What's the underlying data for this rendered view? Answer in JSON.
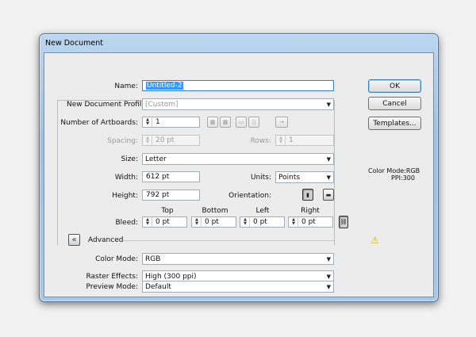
{
  "window": {
    "title": "New Document"
  },
  "form": {
    "name_label": "Name:",
    "name_value": "Untitled-2",
    "profile_label": "New Document Profile:",
    "profile_value": "[Custom]",
    "artboards_label": "Number of Artboards:",
    "artboards_value": "1",
    "spacing_label": "Spacing:",
    "spacing_value": "20 pt",
    "rows_label": "Rows:",
    "rows_value": "1",
    "size_label": "Size:",
    "size_value": "Letter",
    "width_label": "Width:",
    "width_value": "612 pt",
    "units_label": "Units:",
    "units_value": "Points",
    "height_label": "Height:",
    "height_value": "792 pt",
    "orientation_label": "Orientation:",
    "bleed_label": "Bleed:",
    "bleed": {
      "top_label": "Top",
      "top_value": "0 pt",
      "bottom_label": "Bottom",
      "bottom_value": "0 pt",
      "left_label": "Left",
      "left_value": "0 pt",
      "right_label": "Right",
      "right_value": "0 pt"
    },
    "advanced_label": "Advanced",
    "color_mode_label": "Color Mode:",
    "color_mode_value": "RGB",
    "raster_label": "Raster Effects:",
    "raster_value": "High (300 ppi)",
    "preview_label": "Preview Mode:",
    "preview_value": "Default"
  },
  "buttons": {
    "ok": "OK",
    "cancel": "Cancel",
    "templates": "Templates..."
  },
  "info": {
    "color_mode": "Color Mode:RGB",
    "ppi": "PPI:300"
  },
  "icons": {
    "spin_up": "▲",
    "spin_down": "▼",
    "dropdown": "▼",
    "advanced_toggle": "«",
    "warning": "⚠",
    "link": "⛓",
    "portrait": "▮",
    "landscape": "▬"
  },
  "colors": {
    "accent": "#3399ff",
    "warning": "#e8c000",
    "title_bar": "#a9c8e8"
  }
}
